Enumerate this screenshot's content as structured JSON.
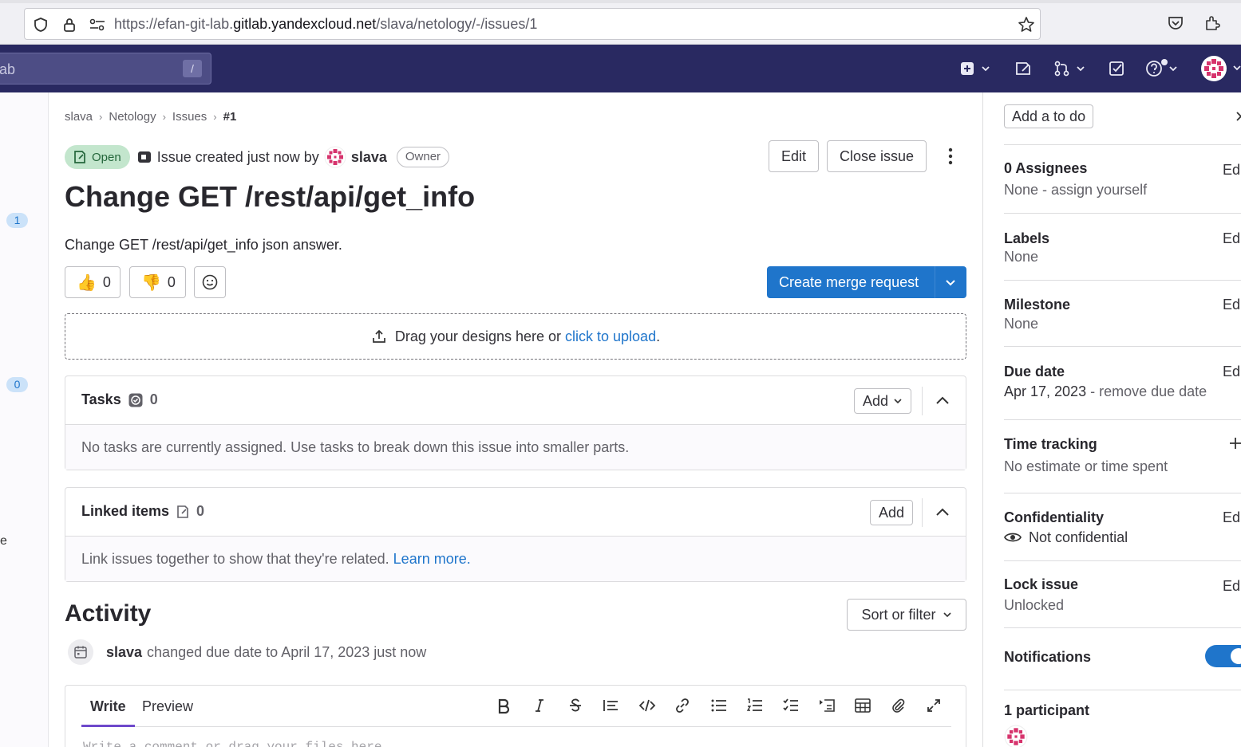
{
  "browser": {
    "url_prefix": "https://efan-git-lab.",
    "url_domain": "gitlab.yandexcloud.net",
    "url_path": "/slava/netology/-/issues/1"
  },
  "topnav": {
    "search_text": "ab",
    "search_shortcut": "/"
  },
  "leftrail": {
    "badge_1": "1",
    "badge_2": "0",
    "fragment": "e"
  },
  "breadcrumb": {
    "items": [
      "slava",
      "Netology",
      "Issues"
    ],
    "current": "#1"
  },
  "issue": {
    "status": "Open",
    "created_text": "Issue created just now by",
    "author": "slava",
    "author_role": "Owner",
    "edit_label": "Edit",
    "close_label": "Close issue",
    "title": "Change GET /rest/api/get_info",
    "description": "Change GET /rest/api/get_info json answer.",
    "thumbs_up": "0",
    "thumbs_down": "0",
    "create_mr_label": "Create merge request"
  },
  "dropzone": {
    "text": "Drag your designs here or",
    "link": "click to upload",
    "suffix": "."
  },
  "tasks": {
    "title": "Tasks",
    "count": "0",
    "add_label": "Add",
    "empty_text": "No tasks are currently assigned. Use tasks to break down this issue into smaller parts."
  },
  "linked": {
    "title": "Linked items",
    "count": "0",
    "add_label": "Add",
    "empty_text": "Link issues together to show that they're related.",
    "learn_more": "Learn more."
  },
  "activity": {
    "title": "Activity",
    "sort_label": "Sort or filter",
    "item_author": "slava",
    "item_text": "changed due date to April 17, 2023 just now"
  },
  "editor": {
    "tab_write": "Write",
    "tab_preview": "Preview",
    "placeholder": "Write a comment or drag your files here…"
  },
  "sidebar": {
    "todo_label": "Add a to do",
    "edit_label": "Edit",
    "assignees_label": "0 Assignees",
    "assignees_value": "None - assign yourself",
    "labels_label": "Labels",
    "labels_value": "None",
    "milestone_label": "Milestone",
    "milestone_value": "None",
    "due_label": "Due date",
    "due_value": "Apr 17, 2023",
    "due_remove": "- remove due date",
    "time_label": "Time tracking",
    "time_value": "No estimate or time spent",
    "conf_label": "Confidentiality",
    "conf_value": "Not confidential",
    "lock_label": "Lock issue",
    "lock_value": "Unlocked",
    "notif_label": "Notifications",
    "participants_label": "1 participant"
  },
  "colors": {
    "nav_bg": "#292961",
    "primary": "#1f75cb",
    "open_bg": "#c3e6cd",
    "open_fg": "#24663b",
    "avatar": "#d6336c"
  }
}
